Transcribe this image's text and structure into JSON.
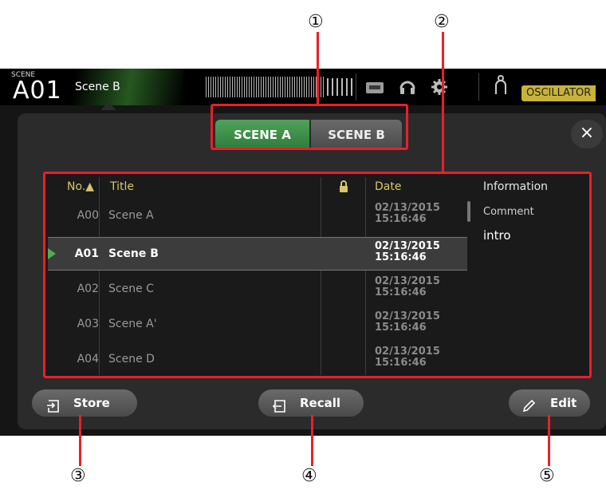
{
  "callouts": {
    "c1": "①",
    "c2": "②",
    "c3": "③",
    "c4": "④",
    "c5": "⑤"
  },
  "top_bar": {
    "scene_small_label": "SCENE",
    "scene_number": "A01",
    "scene_name": "Scene B",
    "oscillator_badge": "OSCILLATOR"
  },
  "tabs": {
    "scene_a": "SCENE A",
    "scene_b": "SCENE B",
    "active": "scene_a"
  },
  "close_label": "×",
  "table": {
    "headers": {
      "no": "No.▲",
      "title": "Title",
      "date": "Date",
      "information": "Information"
    },
    "rows": [
      {
        "no": "A00",
        "title": "Scene A",
        "date": "02/13/2015",
        "time": "15:16:46"
      },
      {
        "no": "A01",
        "title": "Scene B",
        "date": "02/13/2015",
        "time": "15:16:46"
      },
      {
        "no": "A02",
        "title": "Scene C",
        "date": "02/13/2015",
        "time": "15:16:46"
      },
      {
        "no": "A03",
        "title": "Scene A'",
        "date": "02/13/2015",
        "time": "15:16:46"
      },
      {
        "no": "A04",
        "title": "Scene D",
        "date": "02/13/2015",
        "time": "15:16:46"
      }
    ],
    "selected_index": 1
  },
  "information": {
    "comment_label": "Comment",
    "comment_text": "intro"
  },
  "buttons": {
    "store": "Store",
    "recall": "Recall",
    "edit": "Edit"
  },
  "colors": {
    "accent_green": "#4fa35a",
    "callout_red": "#e8202a",
    "header_gold": "#d8c66a",
    "oscillator_gold": "#c9b23a"
  }
}
